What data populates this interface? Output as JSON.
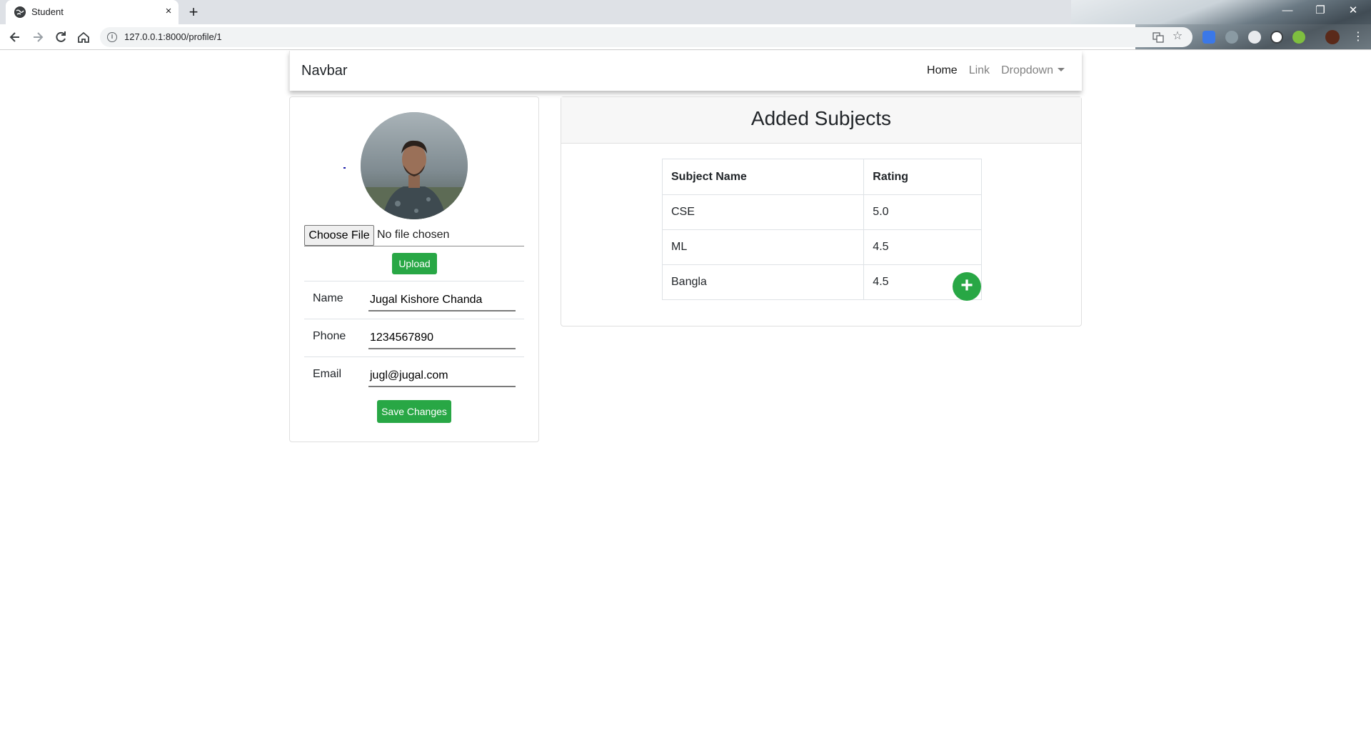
{
  "browser": {
    "tab_title": "Student",
    "tab_close": "×",
    "new_tab": "+",
    "url": "127.0.0.1:8000/profile/1",
    "window_controls": {
      "minimize": "—",
      "restore": "❐",
      "close": "✕"
    }
  },
  "navbar": {
    "brand": "Navbar",
    "links": {
      "home": "Home",
      "link": "Link",
      "dropdown": "Dropdown"
    }
  },
  "profile": {
    "file_input": {
      "button": "Choose File",
      "status": "No file chosen"
    },
    "upload_label": "Upload",
    "fields": [
      {
        "label": "Name",
        "value": "Jugal Kishore Chanda"
      },
      {
        "label": "Phone",
        "value": "1234567890"
      },
      {
        "label": "Email",
        "value": "jugl@jugal.com"
      }
    ],
    "save_label": "Save Changes"
  },
  "subjects": {
    "title": "Added Subjects",
    "columns": [
      "Subject Name",
      "Rating"
    ],
    "rows": [
      {
        "subject": "CSE",
        "rating": "5.0"
      },
      {
        "subject": "ML",
        "rating": "4.5"
      },
      {
        "subject": "Bangla",
        "rating": "4.5"
      }
    ],
    "add_label": "+"
  },
  "colors": {
    "success": "#28a745",
    "tabbar": "#dee1e6",
    "omnibox": "#f1f3f4"
  },
  "icons": [
    "globe-icon",
    "back-icon",
    "forward-icon",
    "reload-icon",
    "home-icon",
    "info-icon",
    "translate-icon",
    "star-icon",
    "plus-icon"
  ]
}
